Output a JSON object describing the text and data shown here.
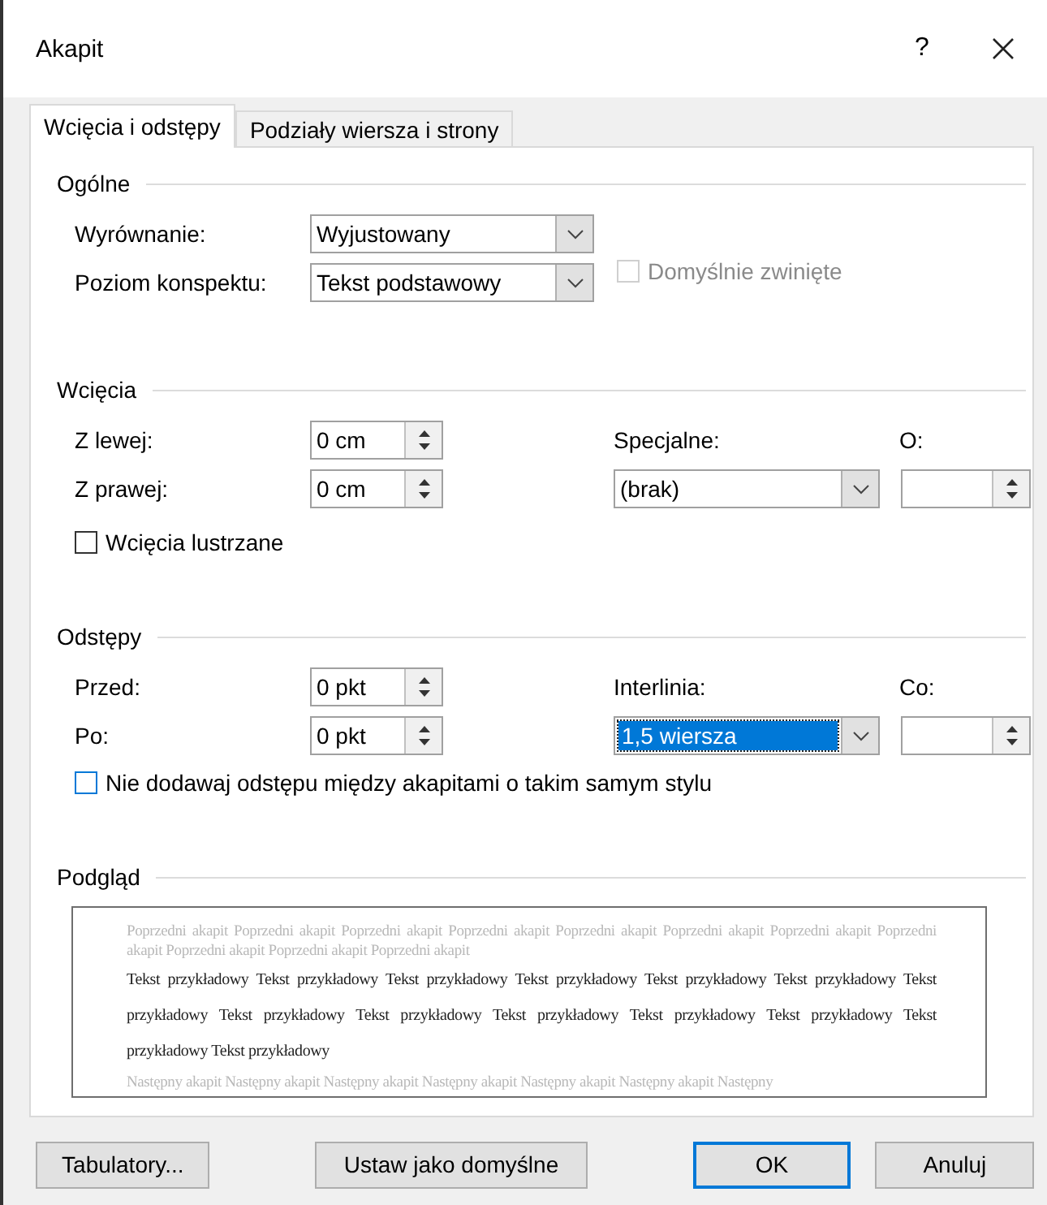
{
  "window": {
    "title": "Akapit",
    "help": "?"
  },
  "tabs": [
    {
      "label": "Wcięcia i odstępy",
      "selected": true
    },
    {
      "label": "Podziały wiersza i strony",
      "selected": false
    }
  ],
  "general": {
    "title": "Ogólne",
    "alignment": {
      "label": "Wyrównanie:",
      "value": "Wyjustowany"
    },
    "outline_level": {
      "label": "Poziom konspektu:",
      "value": "Tekst podstawowy"
    },
    "collapsed": {
      "label": "Domyślnie zwinięte",
      "checked": false,
      "disabled": true
    }
  },
  "indents": {
    "title": "Wcięcia",
    "left": {
      "label": "Z lewej:",
      "value": "0 cm"
    },
    "right": {
      "label": "Z prawej:",
      "value": "0 cm"
    },
    "special": {
      "label": "Specjalne:",
      "value": "(brak)",
      "selected": false
    },
    "by": {
      "label": "O:"
    },
    "mirror": {
      "label": "Wcięcia lustrzane",
      "checked": false
    }
  },
  "spacing": {
    "title": "Odstępy",
    "before": {
      "label": "Przed:",
      "value": "0 pkt"
    },
    "after": {
      "label": "Po:",
      "value": "0 pkt"
    },
    "line_spacing": {
      "label": "Interlinia:",
      "value": "1,5 wiersza",
      "selected": true
    },
    "at": {
      "label": "Co:"
    },
    "no_space": {
      "label": "Nie dodawaj odstępu między akapitami o takim samym stylu",
      "checked": false
    }
  },
  "preview": {
    "title": "Podgląd",
    "previous": "Poprzedni akapit Poprzedni akapit Poprzedni akapit Poprzedni akapit Poprzedni akapit Poprzedni akapit Poprzedni akapit Poprzedni akapit Poprzedni akapit Poprzedni akapit Poprzedni akapit",
    "sample": "Tekst przykładowy Tekst przykładowy Tekst przykładowy Tekst przykładowy Tekst przykładowy Tekst przykładowy Tekst przykładowy Tekst przykładowy Tekst przykładowy Tekst przykładowy Tekst przykładowy Tekst przykładowy Tekst przykładowy Tekst przykładowy",
    "next": "Następny akapit Następny akapit Następny akapit Następny akapit Następny akapit Następny akapit Następny"
  },
  "buttons": [
    {
      "label": "Tabulatory...",
      "default": false
    },
    {
      "label": "Ustaw jako domyślne",
      "default": false
    },
    {
      "label": "OK",
      "default": true
    },
    {
      "label": "Anuluj",
      "default": false
    }
  ]
}
